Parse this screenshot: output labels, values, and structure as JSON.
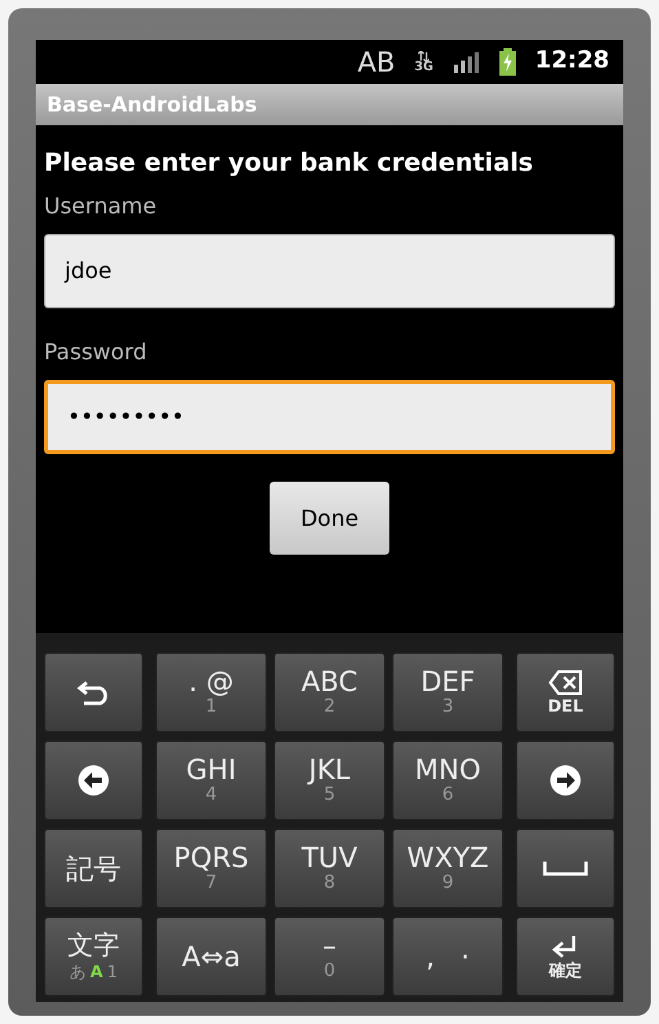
{
  "status_bar": {
    "input_indicator": "AB",
    "network_label": "3G",
    "time": "12:28"
  },
  "title_bar": {
    "title": "Base-AndroidLabs"
  },
  "form": {
    "heading": "Please enter your bank credentials",
    "fields": [
      {
        "label": "Username",
        "value": "jdoe",
        "focused": false
      },
      {
        "label": "Password",
        "value": "•••••••••",
        "focused": true
      }
    ],
    "button": "Done"
  },
  "keyboard": {
    "rows": [
      [
        {
          "kind": "back"
        },
        {
          "kind": "letters",
          "label": ". @",
          "sub": "1"
        },
        {
          "kind": "letters",
          "label": "ABC",
          "sub": "2"
        },
        {
          "kind": "letters",
          "label": "DEF",
          "sub": "3"
        },
        {
          "kind": "delete",
          "label": "DEL"
        }
      ],
      [
        {
          "kind": "left"
        },
        {
          "kind": "letters",
          "label": "GHI",
          "sub": "4"
        },
        {
          "kind": "letters",
          "label": "JKL",
          "sub": "5"
        },
        {
          "kind": "letters",
          "label": "MNO",
          "sub": "6"
        },
        {
          "kind": "right"
        }
      ],
      [
        {
          "kind": "text",
          "label": "記号"
        },
        {
          "kind": "letters",
          "label": "PQRS",
          "sub": "7"
        },
        {
          "kind": "letters",
          "label": "TUV",
          "sub": "8"
        },
        {
          "kind": "letters",
          "label": "WXYZ",
          "sub": "9"
        },
        {
          "kind": "space"
        }
      ],
      [
        {
          "kind": "mode",
          "label": "文字",
          "modes": [
            {
              "label": "あ",
              "selected": false
            },
            {
              "label": "A",
              "selected": true
            },
            {
              "label": "1",
              "selected": false
            }
          ]
        },
        {
          "kind": "text",
          "label": "A⇔a"
        },
        {
          "kind": "letters",
          "label": "–",
          "sub": "0"
        },
        {
          "kind": "text",
          "label": ",   ·"
        },
        {
          "kind": "enter",
          "label": "確定"
        }
      ]
    ]
  }
}
